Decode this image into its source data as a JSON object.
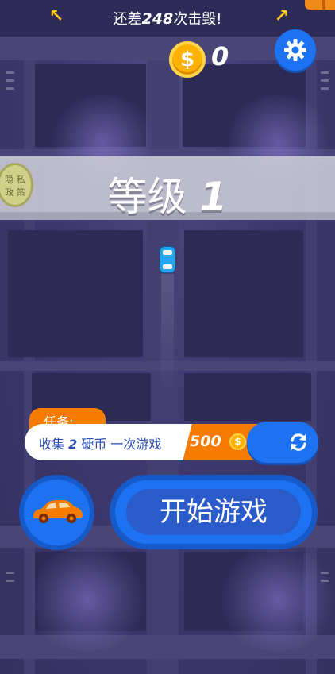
{
  "top_bar": {
    "message_prefix": "还差",
    "remaining": "248",
    "message_suffix": "次击毁!"
  },
  "coins": {
    "symbol": "$",
    "count": "0"
  },
  "level": {
    "label": "等级",
    "number": "1"
  },
  "privacy": {
    "line1": "隐 私",
    "line2": "政 策"
  },
  "mission": {
    "tag": "任务:",
    "text_prefix": "收集",
    "goal": "2",
    "text_suffix": "硬币 一次游戏",
    "reward": "500",
    "reward_symbol": "$"
  },
  "buttons": {
    "start": "开始游戏"
  },
  "icons": [
    "arrow-up-left-icon",
    "arrow-up-right-icon",
    "coin-icon",
    "gear-icon",
    "refresh-icon",
    "car-icon"
  ],
  "colors": {
    "accent_blue": "#1c72f0",
    "accent_orange": "#f57c00",
    "coin_gold": "#ffb300",
    "background": "#3b3666"
  }
}
